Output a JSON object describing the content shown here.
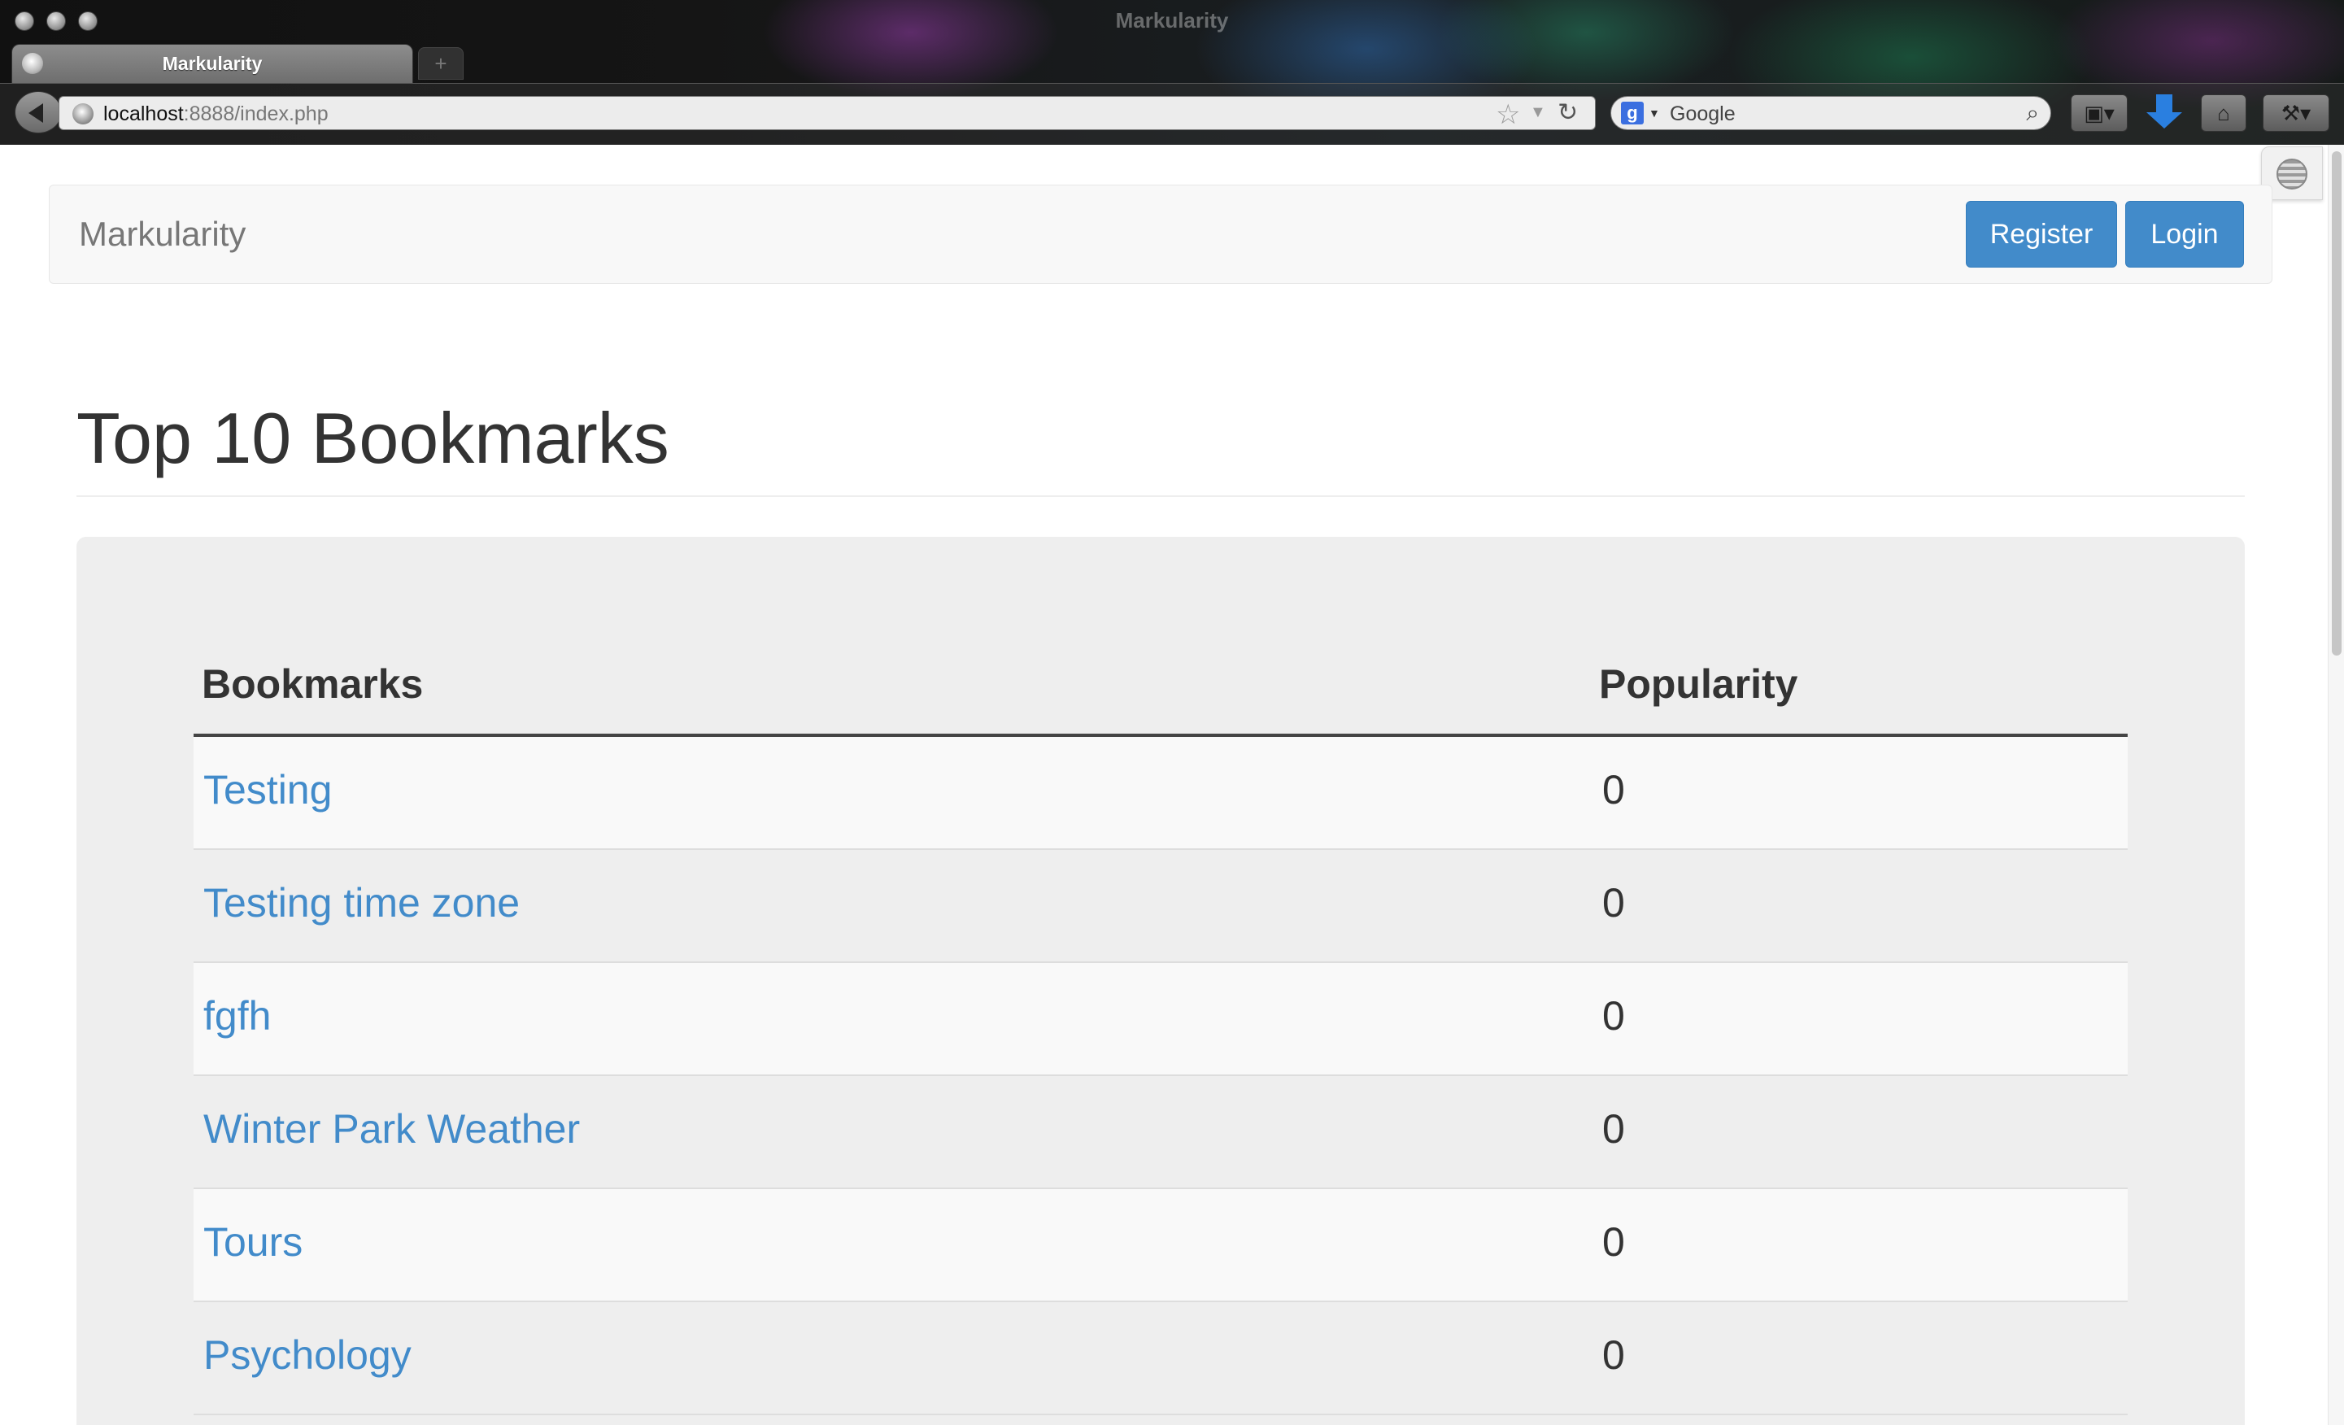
{
  "browser": {
    "window_title": "Markularity",
    "tab_title": "Markularity",
    "new_tab_label": "+",
    "url_host": "localhost",
    "url_rest": ":8888/index.php",
    "search_engine": "Google",
    "search_logo": "g",
    "icons": [
      "back-icon",
      "globe-icon",
      "bookmark-star-icon",
      "reload-icon",
      "google-icon",
      "search-icon",
      "bookmarks-icon",
      "download-icon",
      "home-icon",
      "tools-icon"
    ]
  },
  "navbar": {
    "brand": "Markularity",
    "register_label": "Register",
    "login_label": "Login"
  },
  "main": {
    "title": "Top 10 Bookmarks",
    "table": {
      "headers": [
        "Bookmarks",
        "Popularity"
      ],
      "rows": [
        {
          "name": "Testing",
          "popularity": "0"
        },
        {
          "name": "Testing time zone",
          "popularity": "0"
        },
        {
          "name": "fgfh",
          "popularity": "0"
        },
        {
          "name": "Winter Park Weather",
          "popularity": "0"
        },
        {
          "name": "Tours",
          "popularity": "0"
        },
        {
          "name": "Psychology",
          "popularity": "0"
        }
      ]
    }
  },
  "colors": {
    "link": "#428bca",
    "button": "#428bca",
    "navbar_bg": "#f8f8f8",
    "jumbotron_bg": "#eeeeee"
  }
}
